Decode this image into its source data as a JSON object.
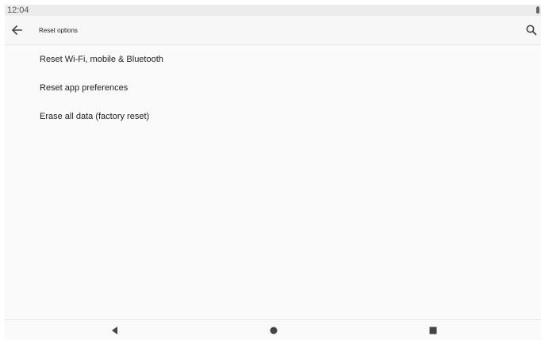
{
  "status_bar": {
    "time": "12:04",
    "battery_icon": "battery-icon"
  },
  "toolbar": {
    "back_icon": "arrow-back-icon",
    "title": "Reset options",
    "search_icon": "search-icon"
  },
  "options": [
    {
      "label": "Reset Wi-Fi, mobile & Bluetooth"
    },
    {
      "label": "Reset app preferences"
    },
    {
      "label": "Erase all data (factory reset)"
    }
  ],
  "nav_bar": {
    "back_icon": "nav-back-icon",
    "home_icon": "nav-home-icon",
    "recents_icon": "nav-recents-icon"
  },
  "colors": {
    "background": "#fafafa",
    "status_bar": "#ececec",
    "text": "#222222",
    "icon": "#444444"
  }
}
